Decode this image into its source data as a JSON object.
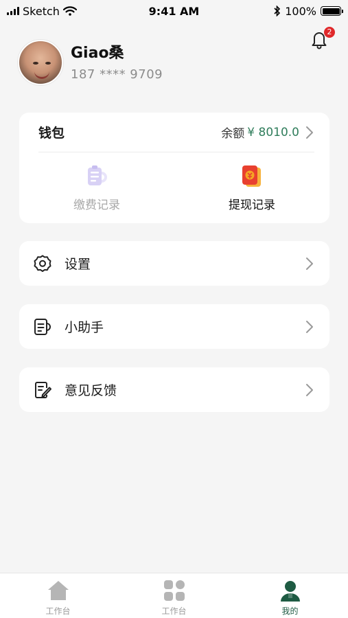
{
  "status_bar": {
    "carrier": "Sketch",
    "time": "9:41 AM",
    "battery": "100%"
  },
  "profile": {
    "name": "Giao桑",
    "phone": "187 **** 9709"
  },
  "notifications": {
    "badge_count": "2"
  },
  "wallet": {
    "title": "钱包",
    "balance_label": "余额",
    "balance_value": "¥ 8010.0",
    "items": [
      {
        "label": "缴费记录",
        "icon": "payment-record-icon"
      },
      {
        "label": "提现记录",
        "icon": "withdraw-record-icon"
      }
    ]
  },
  "menu": [
    {
      "label": "设置",
      "icon": "gear-icon"
    },
    {
      "label": "小助手",
      "icon": "assistant-icon"
    },
    {
      "label": "意见反馈",
      "icon": "feedback-icon"
    }
  ],
  "tabs": [
    {
      "label": "工作台",
      "icon": "home-icon"
    },
    {
      "label": "工作台",
      "icon": "grid-icon"
    },
    {
      "label": "我的",
      "icon": "user-icon",
      "active": true
    }
  ],
  "colors": {
    "accent": "#1e5b43",
    "amount": "#2f7d5b",
    "badge": "#e0282a",
    "background": "#f5f5f5"
  }
}
